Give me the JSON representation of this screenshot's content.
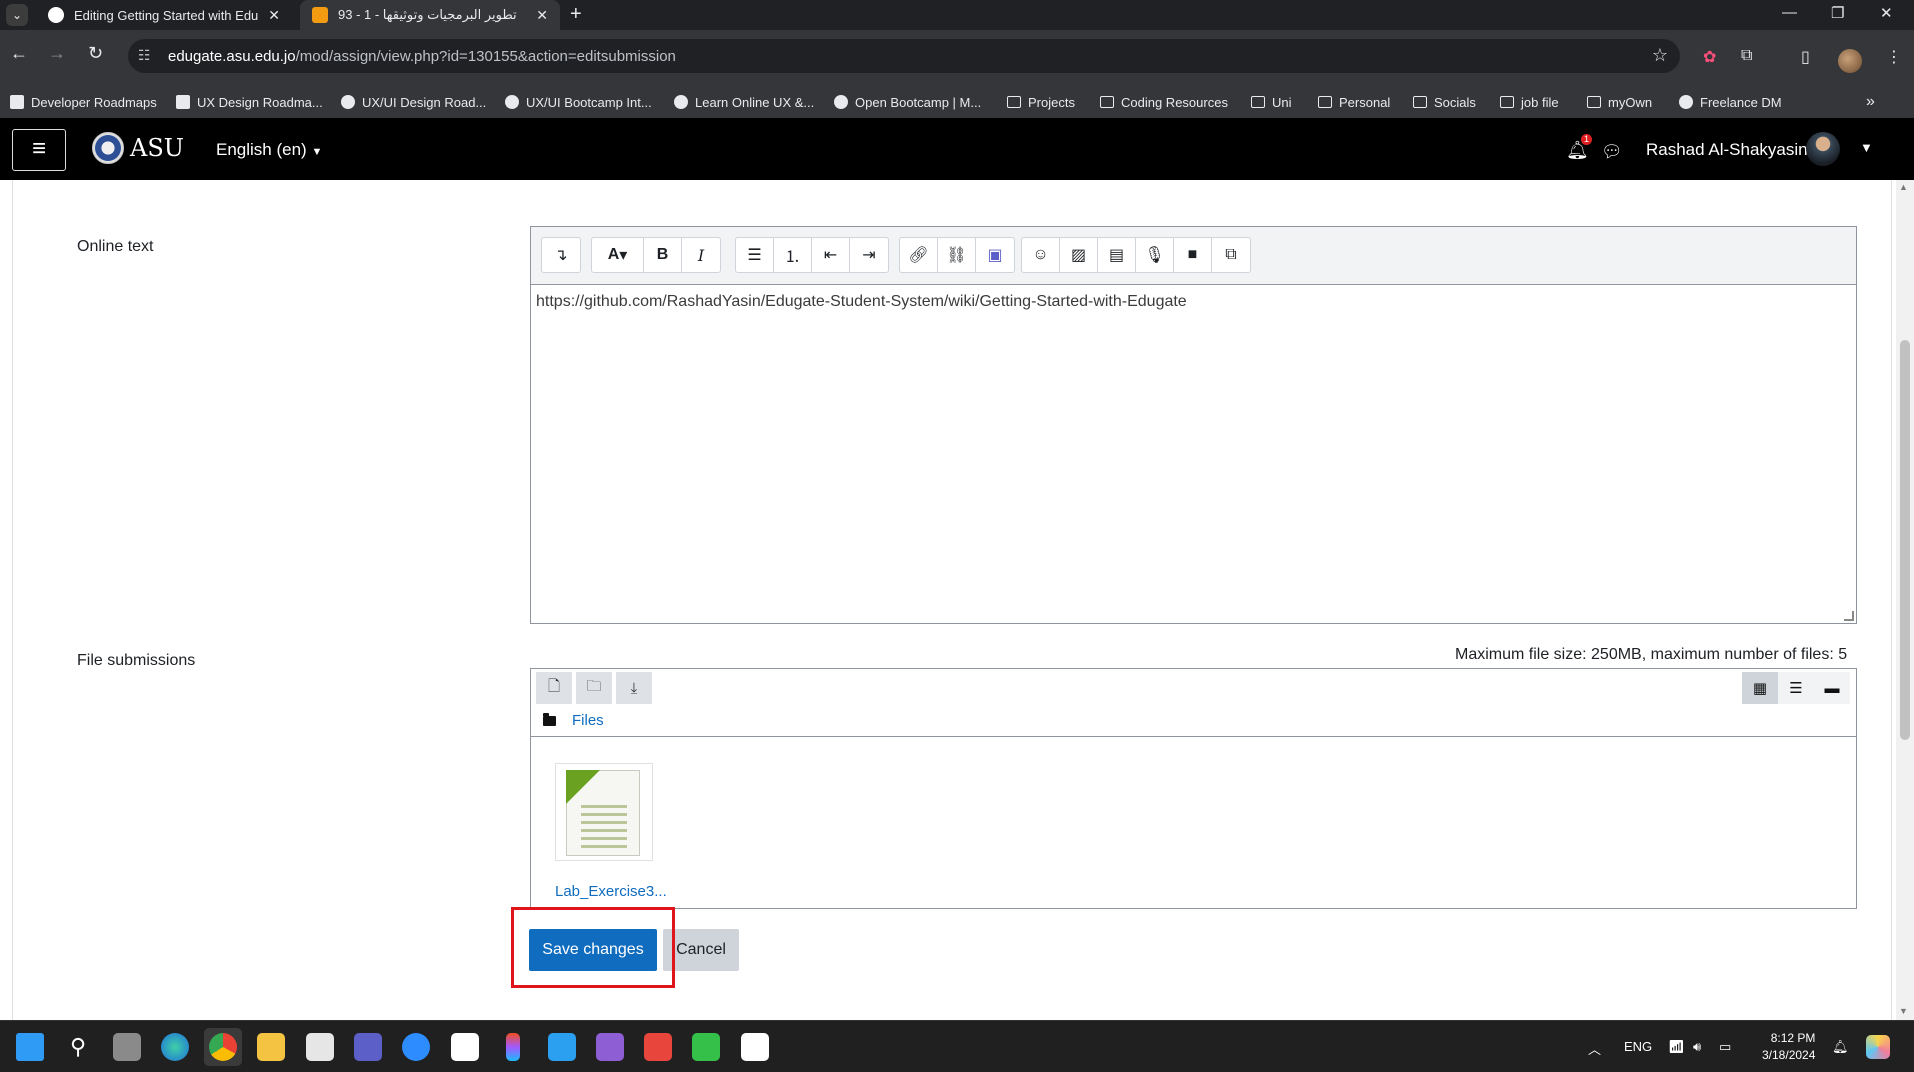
{
  "browser": {
    "tabs": [
      {
        "title": "Editing Getting Started with Edu",
        "favicon_color": "#ffffff"
      },
      {
        "title": "93 - 1 - تطوير البرمجيات وتوثيقها",
        "favicon_color": "#f39c12"
      }
    ],
    "url_host": "edugate.asu.edu.jo",
    "url_path": "/mod/assign/view.php?id=130155&action=editsubmission",
    "bookmarks": [
      {
        "label": "Developer Roadmaps",
        "icon": "roadmap-icon"
      },
      {
        "label": "UX Design Roadma...",
        "icon": "roadmap-icon"
      },
      {
        "label": "UX/UI Design Road...",
        "icon": "eye-icon"
      },
      {
        "label": "UX/UI Bootcamp Int...",
        "icon": "eye-icon"
      },
      {
        "label": "Learn Online UX &...",
        "icon": "eye-icon"
      },
      {
        "label": "Open Bootcamp | M...",
        "icon": "eye-icon"
      },
      {
        "label": "Projects",
        "icon": "folder-icon"
      },
      {
        "label": "Coding Resources",
        "icon": "folder-icon"
      },
      {
        "label": "Uni",
        "icon": "folder-icon"
      },
      {
        "label": "Personal",
        "icon": "folder-icon"
      },
      {
        "label": "Socials",
        "icon": "folder-icon"
      },
      {
        "label": "job file",
        "icon": "folder-icon"
      },
      {
        "label": "myOwn",
        "icon": "folder-icon"
      },
      {
        "label": "Freelance DM",
        "icon": "globe-icon"
      }
    ]
  },
  "navbar": {
    "logo_text": "ASU",
    "language": "English (en)",
    "notification_count": "1",
    "user_name": "Rashad Al-Shakyasin"
  },
  "form": {
    "online_text_label": "Online text",
    "online_text_value": "https://github.com/RashadYasin/Edugate-Student-System/wiki/Getting-Started-with-Edugate",
    "file_submissions_label": "File submissions",
    "max_info": "Maximum file size: 250MB, maximum number of files: 5",
    "breadcrumb": "Files",
    "file_name": "Lab_Exercise3...",
    "save_label": "Save changes",
    "cancel_label": "Cancel"
  },
  "taskbar": {
    "language": "ENG",
    "time": "8:12 PM",
    "date": "3/18/2024"
  },
  "colors": {
    "primary": "#0f6cbf",
    "highlight": "#e0151b",
    "navbar": "#000000"
  }
}
